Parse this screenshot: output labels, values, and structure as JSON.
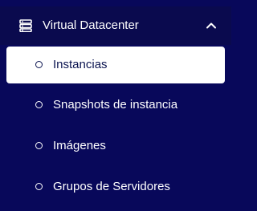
{
  "section": {
    "title": "Virtual Datacenter",
    "icon": "server-icon",
    "toggle_icon": "chevron-up-icon",
    "expanded": true
  },
  "items": [
    {
      "label": "Instancias",
      "active": true
    },
    {
      "label": "Snapshots de instancia",
      "active": false
    },
    {
      "label": "Imágenes",
      "active": false
    },
    {
      "label": "Grupos de Servidores",
      "active": false
    }
  ],
  "colors": {
    "background": "#08085a",
    "header_background": "#0a0a4e",
    "active_background": "#ffffff",
    "active_text": "#0b1450",
    "text": "#ffffff"
  }
}
